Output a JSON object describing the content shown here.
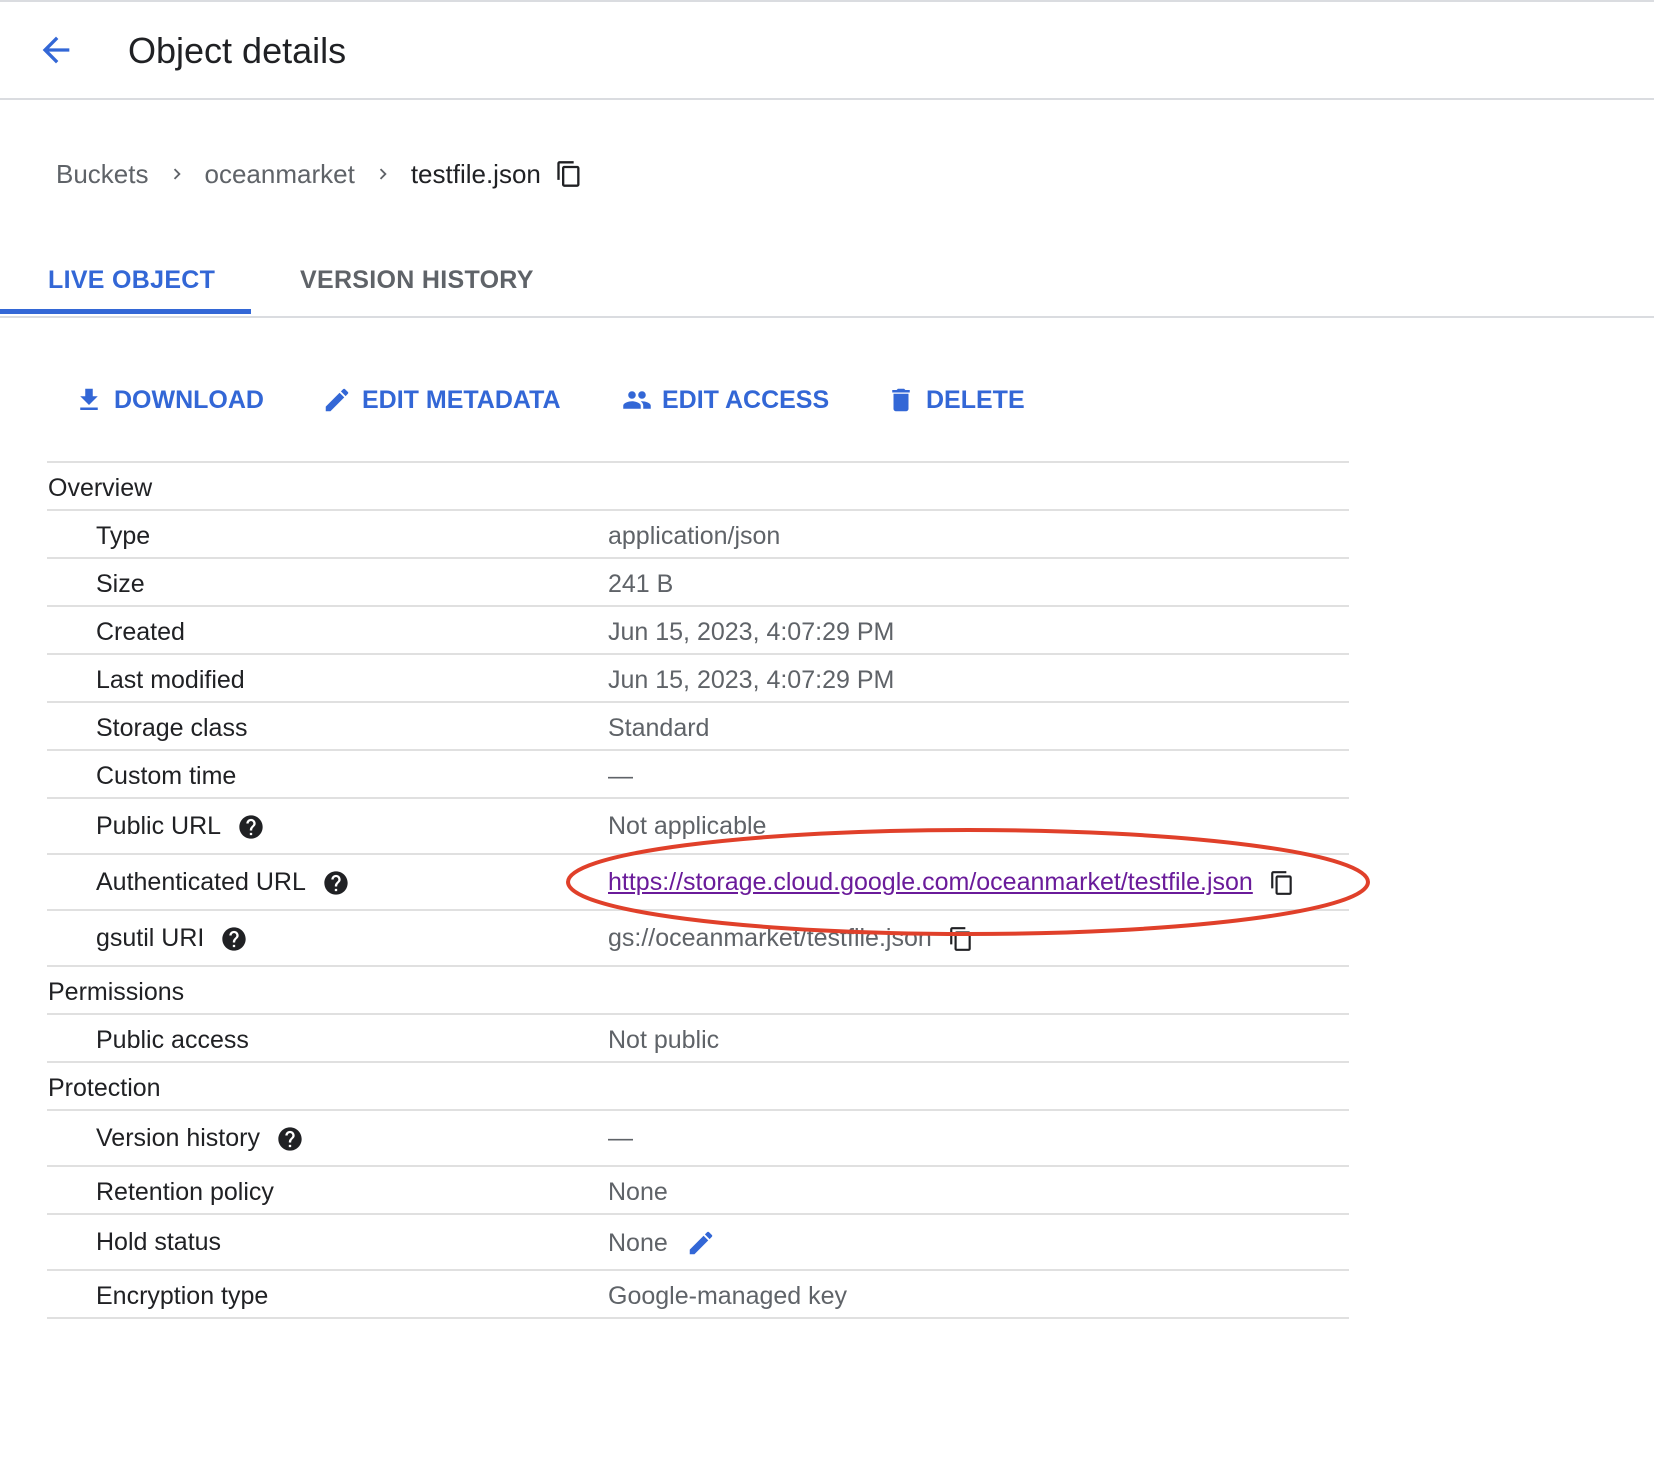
{
  "header": {
    "title": "Object details",
    "back_icon": "arrow-back-icon"
  },
  "breadcrumb": {
    "items": [
      "Buckets",
      "oceanmarket"
    ],
    "current": "testfile.json"
  },
  "tabs": [
    {
      "label": "LIVE OBJECT",
      "active": true
    },
    {
      "label": "VERSION HISTORY",
      "active": false
    }
  ],
  "actions": [
    {
      "label": "DOWNLOAD",
      "icon": "download-icon"
    },
    {
      "label": "EDIT METADATA",
      "icon": "pencil-icon"
    },
    {
      "label": "EDIT ACCESS",
      "icon": "people-icon"
    },
    {
      "label": "DELETE",
      "icon": "trash-icon"
    }
  ],
  "overview": {
    "title": "Overview",
    "rows": [
      {
        "label": "Type",
        "value": "application/json"
      },
      {
        "label": "Size",
        "value": "241 B"
      },
      {
        "label": "Created",
        "value": "Jun 15, 2023, 4:07:29 PM"
      },
      {
        "label": "Last modified",
        "value": "Jun 15, 2023, 4:07:29 PM"
      },
      {
        "label": "Storage class",
        "value": "Standard"
      },
      {
        "label": "Custom time",
        "value": "—"
      },
      {
        "label": "Public URL",
        "value": "Not applicable"
      },
      {
        "label": "Authenticated URL",
        "value": "https://storage.cloud.google.com/oceanmarket/testfile.json"
      },
      {
        "label": "gsutil URI",
        "value": "gs://oceanmarket/testfile.json"
      }
    ]
  },
  "permissions": {
    "title": "Permissions",
    "rows": [
      {
        "label": "Public access",
        "value": "Not public"
      }
    ]
  },
  "protection": {
    "title": "Protection",
    "rows": [
      {
        "label": "Version history",
        "value": "—"
      },
      {
        "label": "Retention policy",
        "value": "None"
      },
      {
        "label": "Hold status",
        "value": "None"
      },
      {
        "label": "Encryption type",
        "value": "Google-managed key"
      }
    ]
  },
  "colors": {
    "accent": "#3367d6",
    "link_visited": "#6a1b9a",
    "annotation": "#e0402a",
    "divider": "#e0e0e0"
  }
}
